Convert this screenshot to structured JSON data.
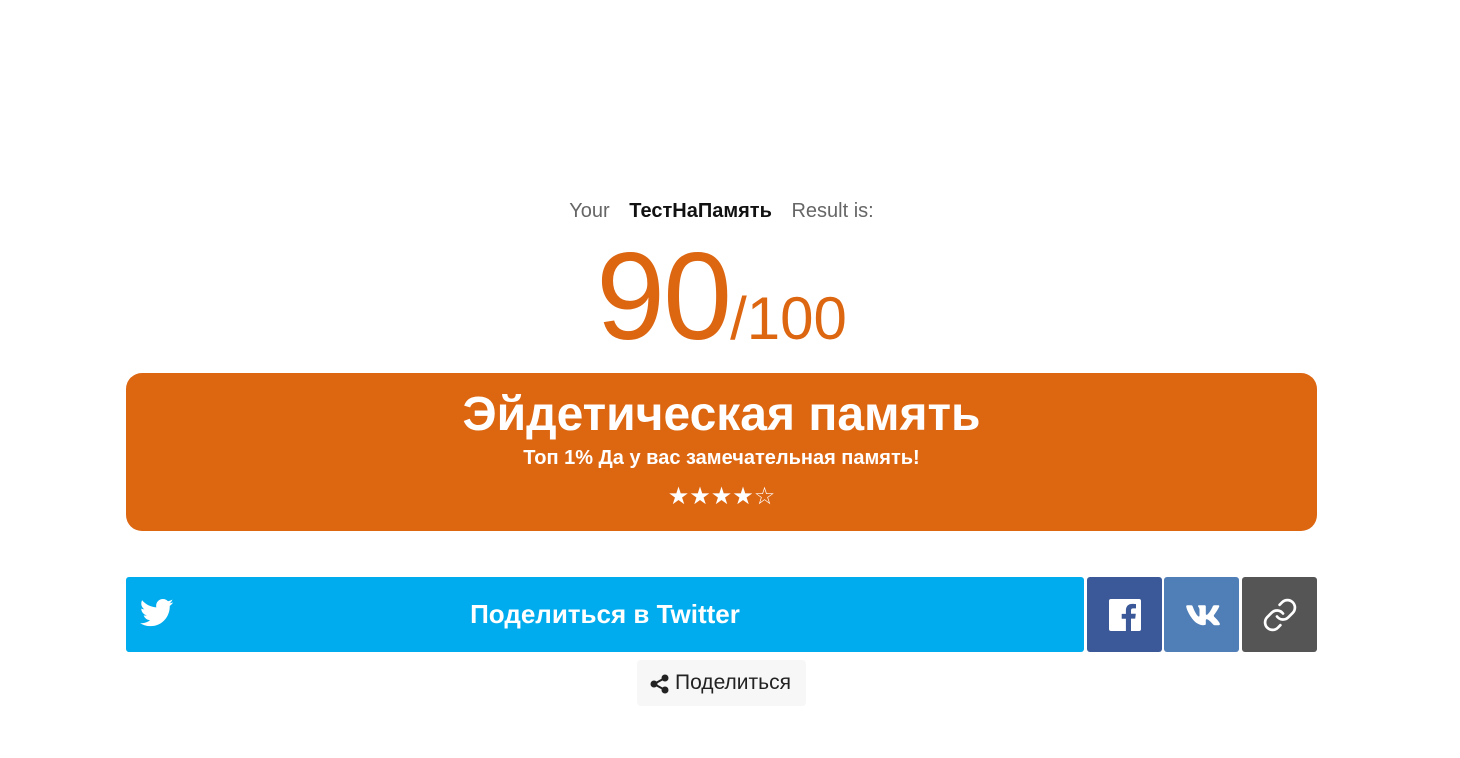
{
  "result": {
    "prefix": "Your",
    "quiz_name": "ТестНаПамять",
    "suffix": "Result is:"
  },
  "score": {
    "value": "90",
    "max": "/100"
  },
  "card": {
    "title": "Эйдетическая память",
    "description": "Топ 1% Да у вас замечательная память!",
    "rating_text": "★★★★☆",
    "rating_value": 4,
    "rating_max": 5
  },
  "share": {
    "twitter_label": "Поделиться в Twitter",
    "native_label": "Поделиться",
    "buttons": [
      {
        "name": "twitter",
        "icon": "twitter-icon",
        "color": "#00aced"
      },
      {
        "name": "facebook",
        "icon": "facebook-icon",
        "color": "#3b5998"
      },
      {
        "name": "vk",
        "icon": "vk-icon",
        "color": "#507fb8"
      },
      {
        "name": "copy-link",
        "icon": "link-icon",
        "color": "#555555"
      }
    ]
  },
  "colors": {
    "accent": "#dd6611",
    "text_muted": "#666666"
  }
}
